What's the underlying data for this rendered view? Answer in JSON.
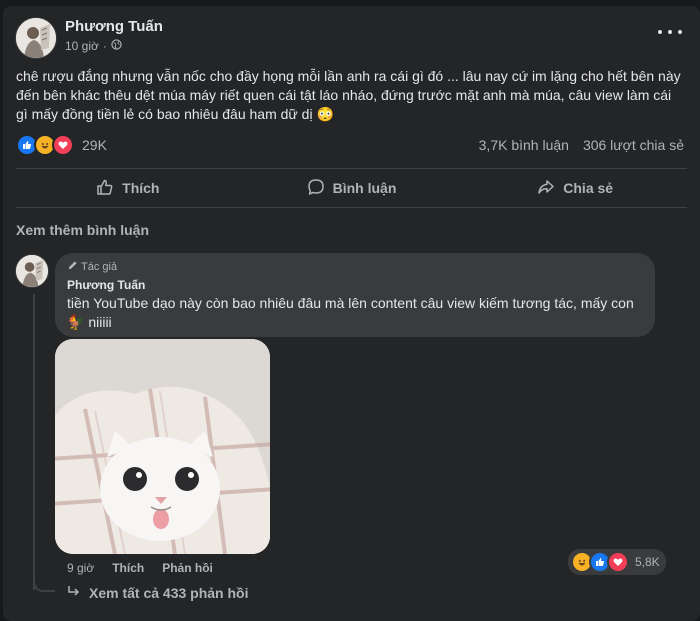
{
  "post": {
    "author": "Phương Tuấn",
    "time": "10 giờ",
    "privacy_icon": "globe-icon",
    "text": "chê rượu đắng nhưng vẫn nốc cho đầy họng mỗi lần anh ra cái gì đó ... lâu nay cứ im lặng cho hết bên này đến bên khác thêu dệt múa máy riết quen cái tật láo nháo, đứng trước mặt anh mà múa, câu view làm cái gì mấy đồng tiền lẻ có bao nhiêu đâu ham dữ dị 😳",
    "reactions": {
      "icons": [
        "like-icon",
        "haha-icon",
        "love-icon"
      ],
      "count": "29K"
    },
    "comments_count": "3,7K bình luận",
    "shares_count": "306 lượt chia sẻ"
  },
  "actions": {
    "like": "Thích",
    "comment": "Bình luận",
    "share": "Chia sẻ"
  },
  "comments_section": {
    "see_more": "Xem thêm bình luận",
    "comment": {
      "badge": "Tác giả",
      "author": "Phương Tuấn",
      "text": "tiền YouTube dạo này còn bao nhiêu đâu mà lên content câu view kiếm tương tác, mấy con 🐓 niiiii",
      "time": "9 giờ",
      "like_label": "Thích",
      "reply_label": "Phản hồi",
      "reactions": {
        "icons": [
          "haha-icon",
          "like-icon",
          "love-icon"
        ],
        "count": "5,8K"
      },
      "view_replies": "Xem tất cả 433 phản hồi"
    }
  },
  "colors": {
    "background": "#18191a",
    "card": "#242526",
    "bubble": "#3a3b3c",
    "text_primary": "#e4e6eb",
    "text_secondary": "#b0b3b8",
    "like_blue": "#1877f2",
    "love_red": "#f33e58",
    "haha_yellow": "#f7b125"
  }
}
